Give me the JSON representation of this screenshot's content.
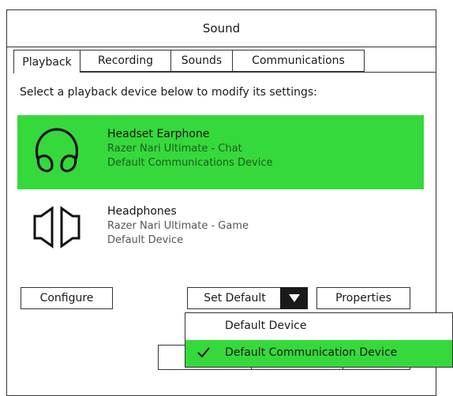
{
  "window": {
    "title": "Sound"
  },
  "tabs": [
    {
      "label": "Playback",
      "active": true
    },
    {
      "label": "Recording",
      "active": false
    },
    {
      "label": "Sounds",
      "active": false
    },
    {
      "label": "Communications",
      "active": false
    }
  ],
  "instruction": "Select a playback device below to modify its settings:",
  "devices": [
    {
      "name": "Headset Earphone",
      "model": "Razer Nari Ultimate - Chat",
      "status": "Default Communications Device",
      "icon": "headset-icon",
      "selected": true
    },
    {
      "name": "Headphones",
      "model": "Razer Nari Ultimate - Game",
      "status": "Default Device",
      "icon": "speaker-icon",
      "selected": false
    }
  ],
  "buttons": {
    "configure": "Configure",
    "set_default": "Set Default",
    "properties": "Properties"
  },
  "set_default_menu": [
    {
      "label": "Default Device",
      "checked": false
    },
    {
      "label": "Default Communication Device",
      "checked": true
    }
  ],
  "colors": {
    "selection": "#36d93b",
    "border": "#333333"
  }
}
